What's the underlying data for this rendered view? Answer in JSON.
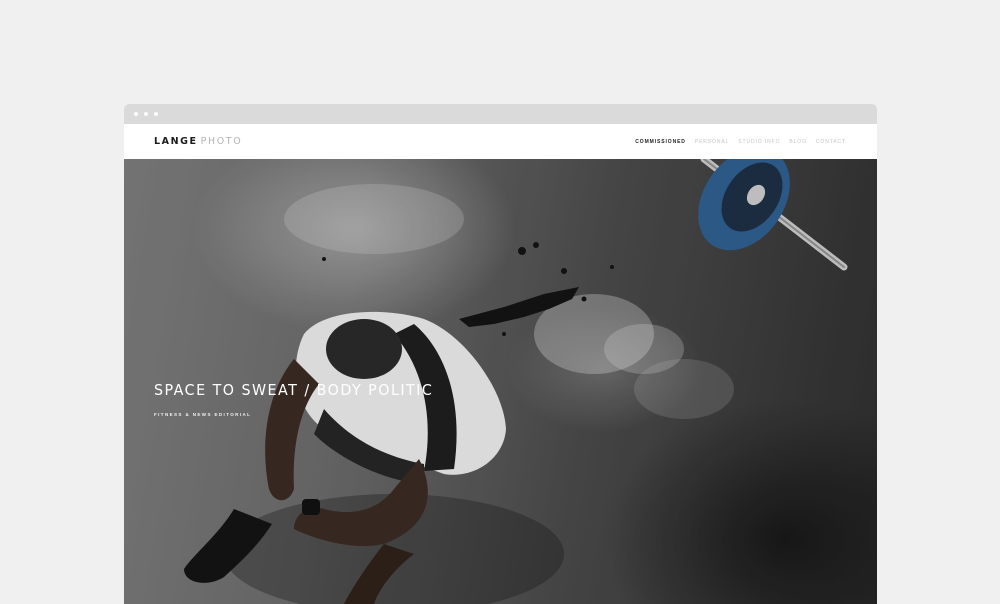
{
  "site": {
    "logo_primary": "LANGE",
    "logo_secondary": "PHOTO"
  },
  "nav": {
    "items": [
      {
        "label": "COMMISSIONED",
        "active": true
      },
      {
        "label": "PERSONAL",
        "active": false
      },
      {
        "label": "STUDIO INFO",
        "active": false
      },
      {
        "label": "BLOG",
        "active": false
      },
      {
        "label": "CONTACT",
        "active": false
      }
    ]
  },
  "hero": {
    "title": "SPACE TO SWEAT / BODY POLITIC",
    "subtitle": "FITNESS & NEWS EDITORIAL",
    "image": "athlete-seated-on-gym-floor-with-barbell-photo"
  },
  "colors": {
    "page_background": "#f0f0f0",
    "browser_bar": "#dadada",
    "header_background": "#ffffff",
    "nav_active": "#222222",
    "nav_inactive": "#c4c4c4",
    "barbell_plate": "#2f5e8f"
  }
}
